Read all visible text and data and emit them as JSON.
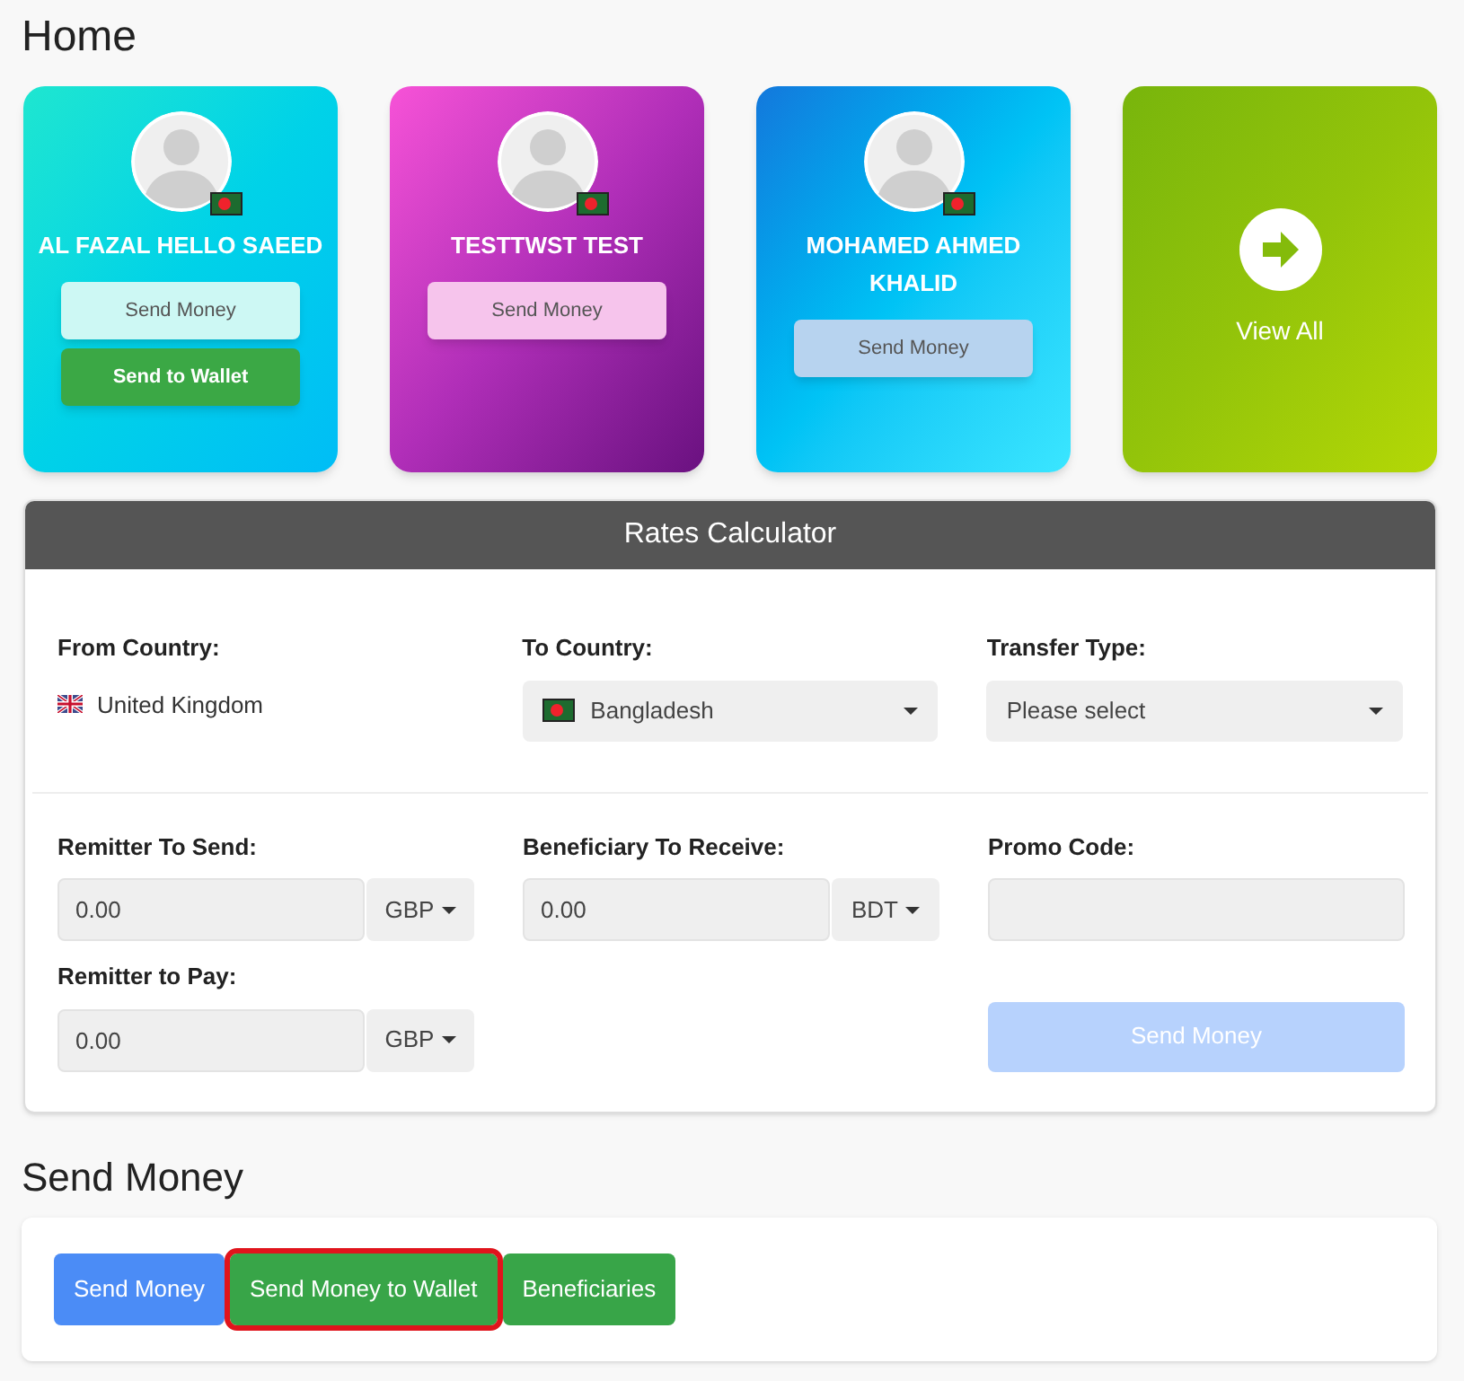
{
  "page_title": "Home",
  "cards": [
    {
      "kind": "beneficiary",
      "name": "AL FAZAL HELLO SAEED",
      "send_button": "Send Money",
      "wallet_button": "Send to Wallet"
    },
    {
      "kind": "beneficiary",
      "name": "TESTTWST TEST",
      "send_button": "Send Money"
    },
    {
      "kind": "beneficiary",
      "name": "MOHAMED AHMED KHALID",
      "send_button": "Send Money"
    },
    {
      "kind": "view_all",
      "label": "View All"
    }
  ],
  "calculator": {
    "title": "Rates Calculator",
    "from_country": {
      "label": "From Country:",
      "value": "United Kingdom"
    },
    "to_country": {
      "label": "To Country:",
      "value": "Bangladesh"
    },
    "transfer_type": {
      "label": "Transfer Type:",
      "value": "Please select"
    },
    "remitter_send": {
      "label": "Remitter To Send:",
      "value": "0.00",
      "currency": "GBP"
    },
    "beneficiary_receive": {
      "label": "Beneficiary To Receive:",
      "value": "0.00",
      "currency": "BDT"
    },
    "promo_code": {
      "label": "Promo Code:"
    },
    "remitter_pay": {
      "label": "Remitter to Pay:",
      "value": "0.00",
      "currency": "GBP"
    },
    "send_button": {
      "label": "Send Money",
      "disabled": true
    }
  },
  "send_section": {
    "title": "Send Money",
    "buttons": [
      {
        "label": "Send Money",
        "kind": "primary",
        "highlighted": false
      },
      {
        "label": "Send Money to Wallet",
        "kind": "success",
        "highlighted": true
      },
      {
        "label": "Beneficiaries",
        "kind": "success",
        "highlighted": false
      }
    ]
  }
}
